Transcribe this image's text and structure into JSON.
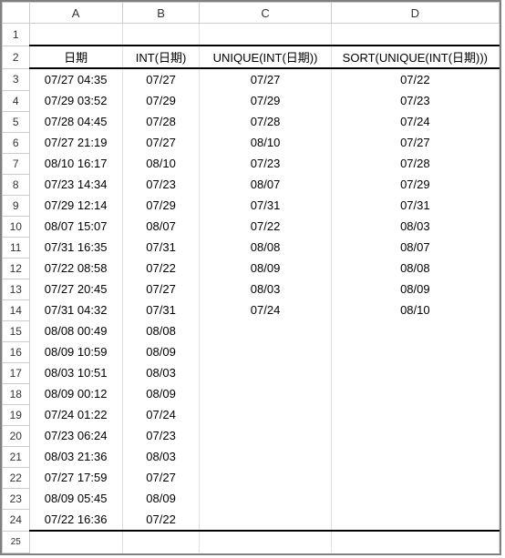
{
  "columns": [
    "A",
    "B",
    "C",
    "D"
  ],
  "rowNumbers": [
    1,
    2,
    3,
    4,
    5,
    6,
    7,
    8,
    9,
    10,
    11,
    12,
    13,
    14,
    15,
    16,
    17,
    18,
    19,
    20,
    21,
    22,
    23,
    24,
    25
  ],
  "headers": {
    "A": "日期",
    "B": "INT(日期)",
    "C": "UNIQUE(INT(日期))",
    "D": "SORT(UNIQUE(INT(日期)))"
  },
  "rows": [
    {
      "A": "07/27 04:35",
      "B": "07/27",
      "C": "07/27",
      "D": "07/22"
    },
    {
      "A": "07/29 03:52",
      "B": "07/29",
      "C": "07/29",
      "D": "07/23"
    },
    {
      "A": "07/28 04:45",
      "B": "07/28",
      "C": "07/28",
      "D": "07/24"
    },
    {
      "A": "07/27 21:19",
      "B": "07/27",
      "C": "08/10",
      "D": "07/27"
    },
    {
      "A": "08/10 16:17",
      "B": "08/10",
      "C": "07/23",
      "D": "07/28"
    },
    {
      "A": "07/23 14:34",
      "B": "07/23",
      "C": "08/07",
      "D": "07/29"
    },
    {
      "A": "07/29 12:14",
      "B": "07/29",
      "C": "07/31",
      "D": "07/31"
    },
    {
      "A": "08/07 15:07",
      "B": "08/07",
      "C": "07/22",
      "D": "08/03"
    },
    {
      "A": "07/31 16:35",
      "B": "07/31",
      "C": "08/08",
      "D": "08/07"
    },
    {
      "A": "07/22 08:58",
      "B": "07/22",
      "C": "08/09",
      "D": "08/08"
    },
    {
      "A": "07/27 20:45",
      "B": "07/27",
      "C": "08/03",
      "D": "08/09"
    },
    {
      "A": "07/31 04:32",
      "B": "07/31",
      "C": "07/24",
      "D": "08/10"
    },
    {
      "A": "08/08 00:49",
      "B": "08/08",
      "C": "",
      "D": ""
    },
    {
      "A": "08/09 10:59",
      "B": "08/09",
      "C": "",
      "D": ""
    },
    {
      "A": "08/03 10:51",
      "B": "08/03",
      "C": "",
      "D": ""
    },
    {
      "A": "08/09 00:12",
      "B": "08/09",
      "C": "",
      "D": ""
    },
    {
      "A": "07/24 01:22",
      "B": "07/24",
      "C": "",
      "D": ""
    },
    {
      "A": "07/23 06:24",
      "B": "07/23",
      "C": "",
      "D": ""
    },
    {
      "A": "08/03 21:36",
      "B": "08/03",
      "C": "",
      "D": ""
    },
    {
      "A": "07/27 17:59",
      "B": "07/27",
      "C": "",
      "D": ""
    },
    {
      "A": "08/09 05:45",
      "B": "08/09",
      "C": "",
      "D": ""
    },
    {
      "A": "07/22 16:36",
      "B": "07/22",
      "C": "",
      "D": ""
    }
  ],
  "chart_data": {
    "type": "table",
    "title": "",
    "columns": [
      "日期",
      "INT(日期)",
      "UNIQUE(INT(日期))",
      "SORT(UNIQUE(INT(日期)))"
    ],
    "series": [
      {
        "name": "日期",
        "values": [
          "07/27 04:35",
          "07/29 03:52",
          "07/28 04:45",
          "07/27 21:19",
          "08/10 16:17",
          "07/23 14:34",
          "07/29 12:14",
          "08/07 15:07",
          "07/31 16:35",
          "07/22 08:58",
          "07/27 20:45",
          "07/31 04:32",
          "08/08 00:49",
          "08/09 10:59",
          "08/03 10:51",
          "08/09 00:12",
          "07/24 01:22",
          "07/23 06:24",
          "08/03 21:36",
          "07/27 17:59",
          "08/09 05:45",
          "07/22 16:36"
        ]
      },
      {
        "name": "INT(日期)",
        "values": [
          "07/27",
          "07/29",
          "07/28",
          "07/27",
          "08/10",
          "07/23",
          "07/29",
          "08/07",
          "07/31",
          "07/22",
          "07/27",
          "07/31",
          "08/08",
          "08/09",
          "08/03",
          "08/09",
          "07/24",
          "07/23",
          "08/03",
          "07/27",
          "08/09",
          "07/22"
        ]
      },
      {
        "name": "UNIQUE(INT(日期))",
        "values": [
          "07/27",
          "07/29",
          "07/28",
          "08/10",
          "07/23",
          "08/07",
          "07/31",
          "07/22",
          "08/08",
          "08/09",
          "08/03",
          "07/24"
        ]
      },
      {
        "name": "SORT(UNIQUE(INT(日期)))",
        "values": [
          "07/22",
          "07/23",
          "07/24",
          "07/27",
          "07/28",
          "07/29",
          "07/31",
          "08/03",
          "08/07",
          "08/08",
          "08/09",
          "08/10"
        ]
      }
    ]
  }
}
